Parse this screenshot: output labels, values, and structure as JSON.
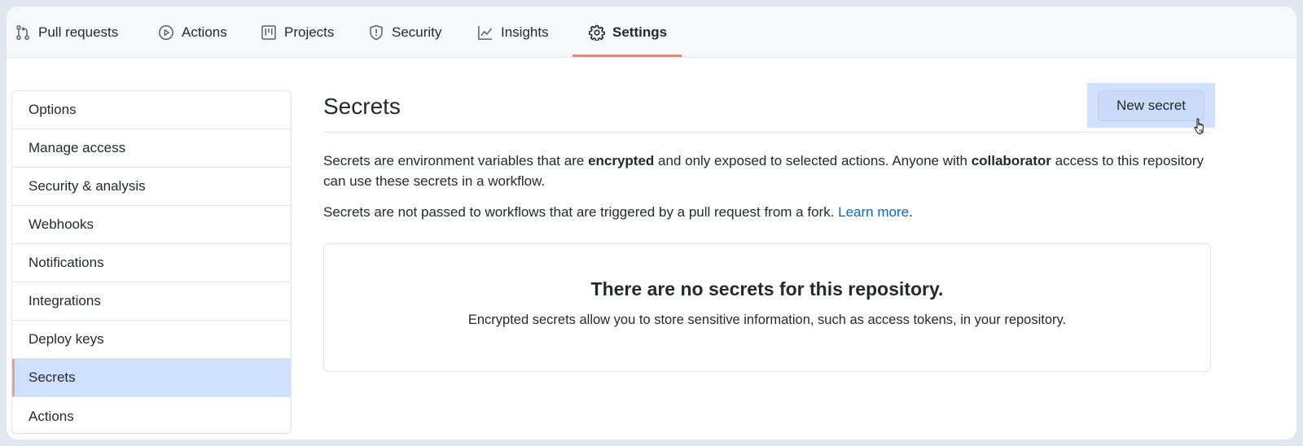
{
  "topnav": {
    "tabs": [
      {
        "label": "Pull requests",
        "icon": "git-pull-request-icon"
      },
      {
        "label": "Actions",
        "icon": "play-icon"
      },
      {
        "label": "Projects",
        "icon": "project-icon"
      },
      {
        "label": "Security",
        "icon": "shield-icon"
      },
      {
        "label": "Insights",
        "icon": "graph-icon"
      },
      {
        "label": "Settings",
        "icon": "gear-icon",
        "selected": true
      }
    ]
  },
  "sidebar": {
    "items": [
      {
        "label": "Options"
      },
      {
        "label": "Manage access"
      },
      {
        "label": "Security & analysis"
      },
      {
        "label": "Webhooks"
      },
      {
        "label": "Notifications"
      },
      {
        "label": "Integrations"
      },
      {
        "label": "Deploy keys"
      },
      {
        "label": "Secrets",
        "selected": true
      },
      {
        "label": "Actions"
      }
    ]
  },
  "main": {
    "title": "Secrets",
    "new_secret_label": "New secret",
    "description": {
      "part1": "Secrets are environment variables that are ",
      "bold1": "encrypted",
      "part2": " and only exposed to selected actions. Anyone with ",
      "bold2": "collaborator",
      "part3": " access to this repository can use these secrets in a workflow."
    },
    "fork_note": {
      "text": "Secrets are not passed to workflows that are triggered by a pull request from a fork. ",
      "link": "Learn more",
      "suffix": "."
    },
    "blankslate": {
      "title": "There are no secrets for this repository.",
      "text": "Encrypted secrets allow you to store sensitive information, such as access tokens, in your repository."
    }
  },
  "colors": {
    "accent_underline": "#f9826c",
    "selected_bg": "#cfe1ff",
    "link": "#0366d6"
  }
}
